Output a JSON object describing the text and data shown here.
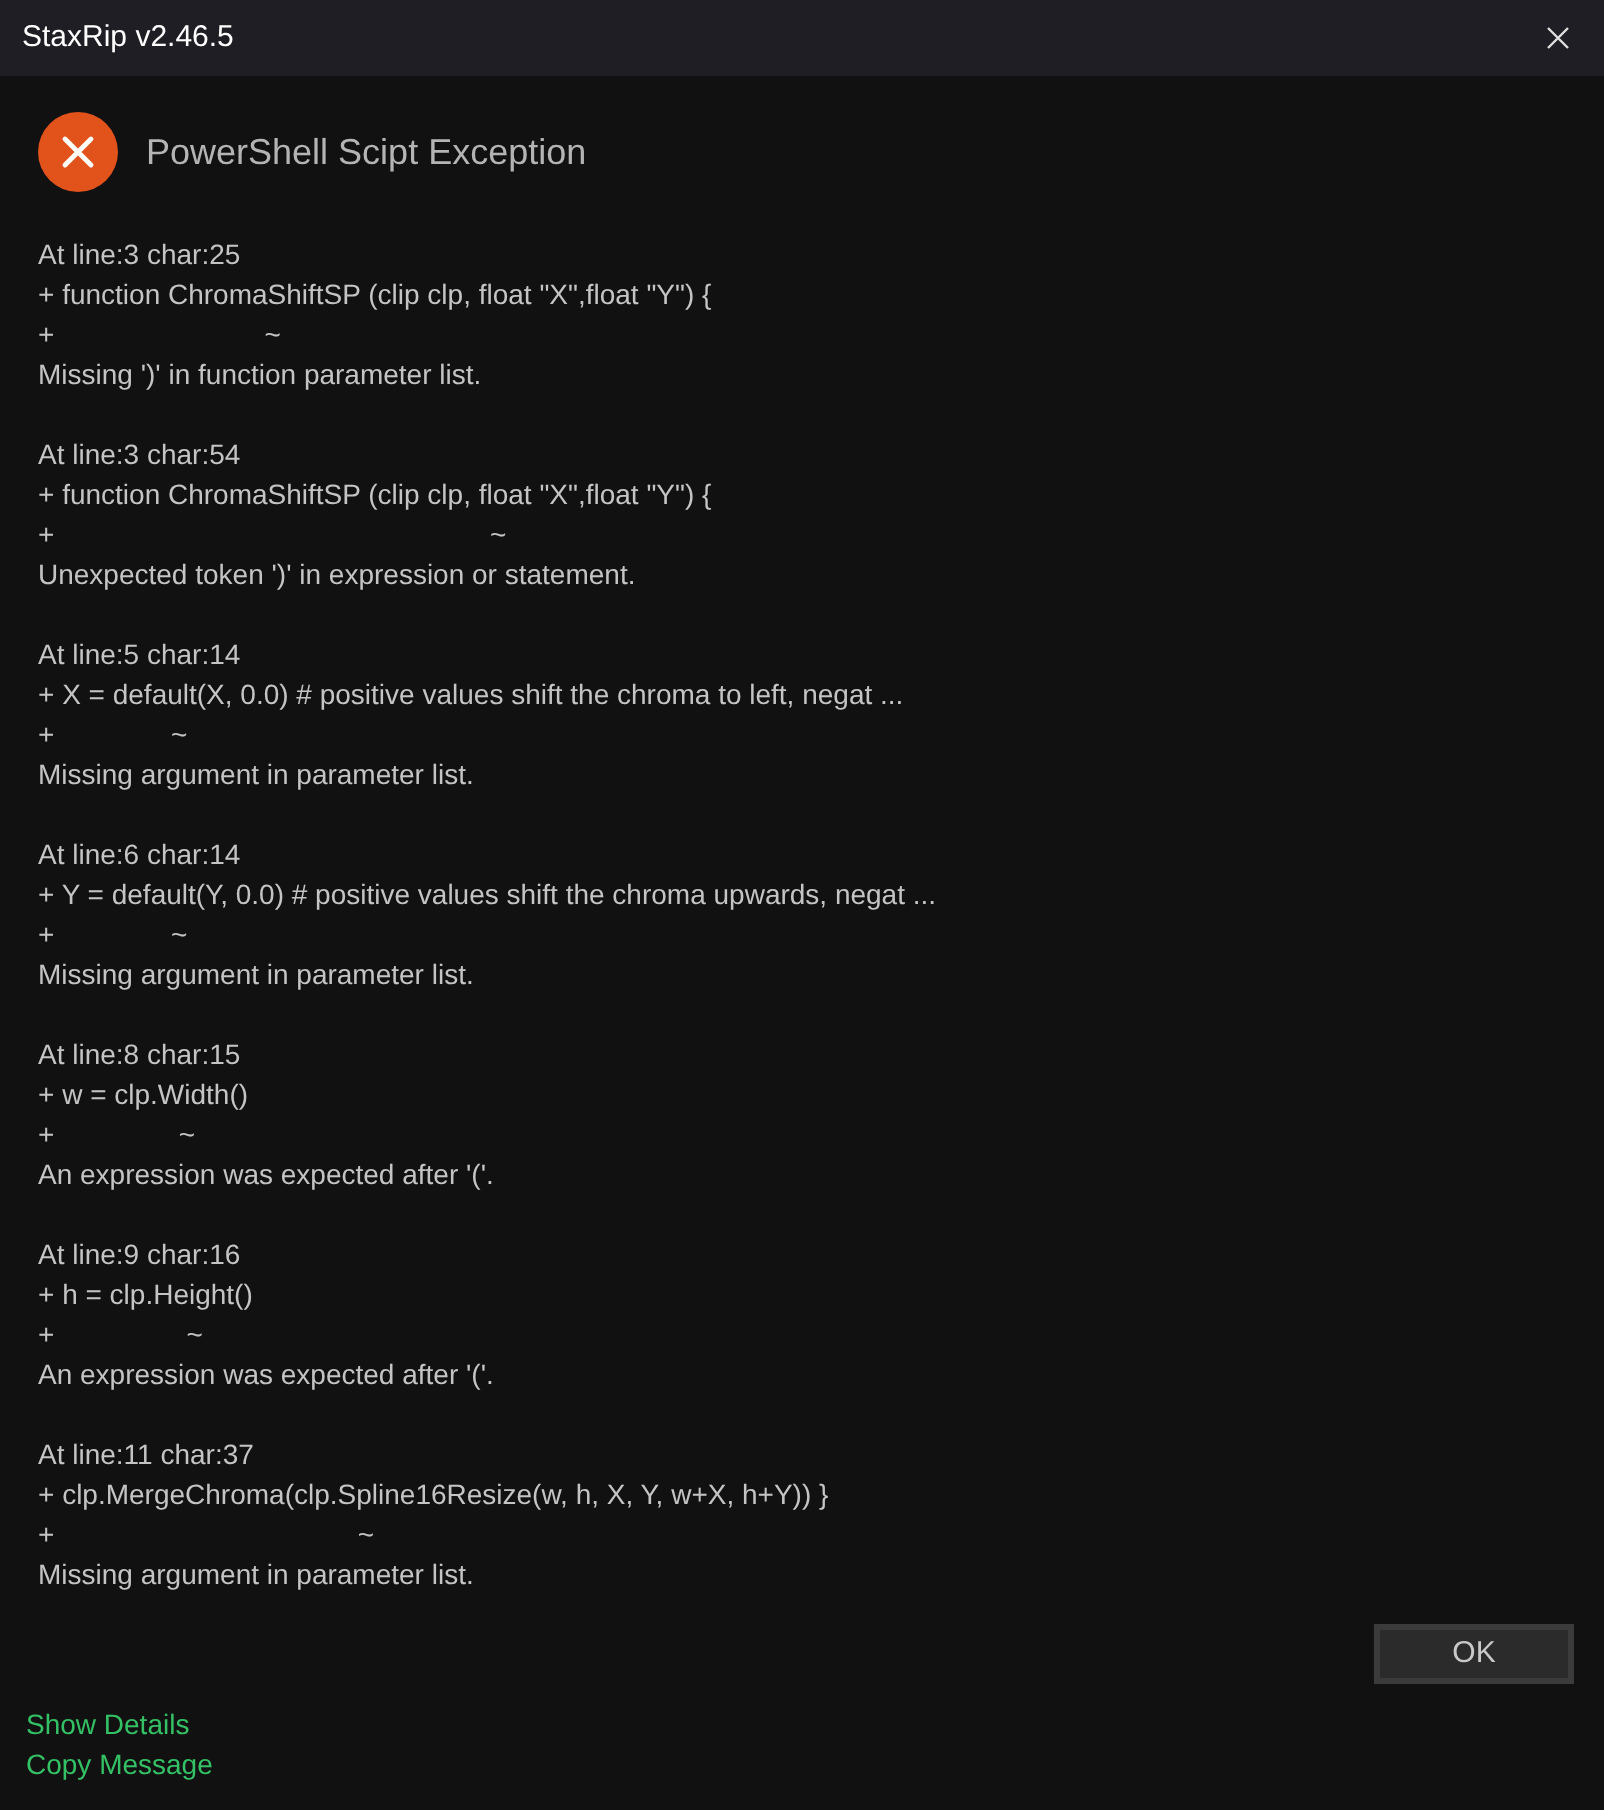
{
  "window": {
    "title": "StaxRip v2.46.5"
  },
  "header": {
    "title": "PowerShell Scipt Exception"
  },
  "errors": [
    {
      "location": "At line:3 char:25",
      "code": "+ function ChromaShiftSP (clip clp, float \"X\",float \"Y\") {",
      "caret": "+                           ~",
      "message": "Missing ')' in function parameter list."
    },
    {
      "location": "At line:3 char:54",
      "code": "+ function ChromaShiftSP (clip clp, float \"X\",float \"Y\") {",
      "caret": "+                                                        ~",
      "message": "Unexpected token ')' in expression or statement."
    },
    {
      "location": "At line:5 char:14",
      "code": "+ X = default(X, 0.0) # positive values shift the chroma to left, negat ...",
      "caret": "+               ~",
      "message": "Missing argument in parameter list."
    },
    {
      "location": "At line:6 char:14",
      "code": "+ Y = default(Y, 0.0) # positive values shift the chroma upwards, negat ...",
      "caret": "+               ~",
      "message": "Missing argument in parameter list."
    },
    {
      "location": "At line:8 char:15",
      "code": "+ w = clp.Width()",
      "caret": "+                ~",
      "message": "An expression was expected after '('."
    },
    {
      "location": "At line:9 char:16",
      "code": "+ h = clp.Height()",
      "caret": "+                 ~",
      "message": "An expression was expected after '('."
    },
    {
      "location": "At line:11 char:37",
      "code": "+ clp.MergeChroma(clp.Spline16Resize(w, h, X, Y, w+X, h+Y)) }",
      "caret": "+                                       ~",
      "message": "Missing argument in parameter list."
    }
  ],
  "buttons": [
    {
      "label": "OK"
    }
  ],
  "links": [
    {
      "label": "Show Details"
    },
    {
      "label": "Copy Message"
    }
  ]
}
